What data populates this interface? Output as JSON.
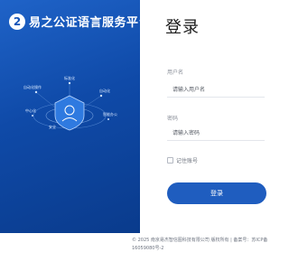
{
  "brand": {
    "logo_glyph": "2",
    "name": "易之公证语言服务平台"
  },
  "illustration": {
    "labels": {
      "top_center": "标准化",
      "left_upper": "自动化操作",
      "left_lower": "中心化",
      "right_upper": "自动化",
      "right_lower": "智能办公",
      "bottom_left": "安全"
    }
  },
  "login": {
    "title": "登录",
    "username_label": "用户名",
    "username_placeholder": "请输入用户名",
    "password_label": "密码",
    "password_placeholder": "请输入密码",
    "remember_label": "记住账号",
    "submit_label": "登录"
  },
  "footer": {
    "text": "© 2025 南京易杰智信图科技有限公司 版权所有 | 备案号：苏ICP备16059080号-2"
  },
  "colors": {
    "brand_blue": "#1f5dbf",
    "panel_dark": "#0a3b8c"
  }
}
